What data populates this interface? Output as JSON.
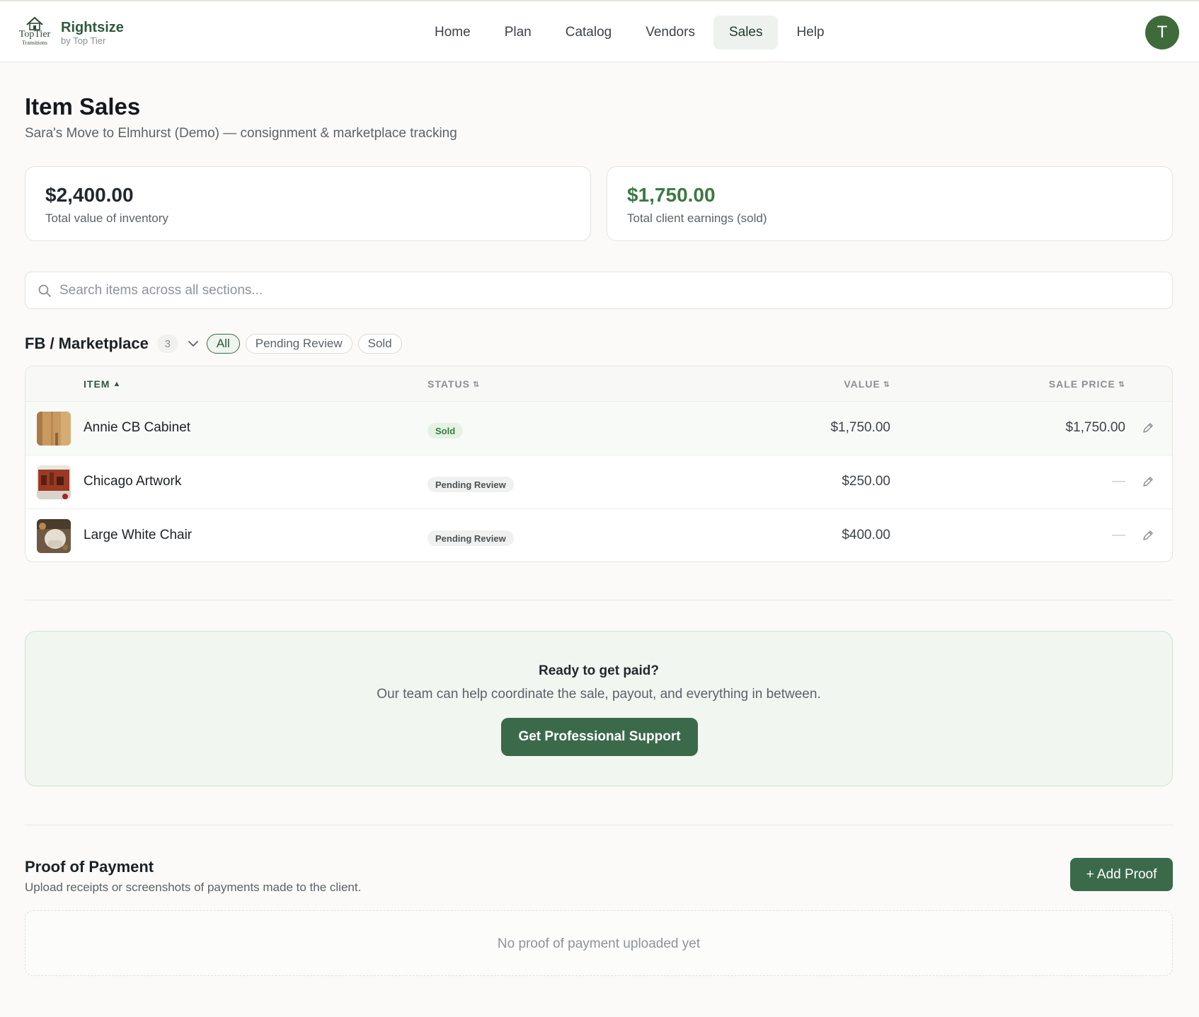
{
  "app": {
    "logo_text": "TopTier",
    "logo_sub": "Transitions",
    "brand_name": "Rightsize",
    "brand_sub": "by Top Tier"
  },
  "nav": {
    "items": [
      {
        "label": "Home"
      },
      {
        "label": "Plan"
      },
      {
        "label": "Catalog"
      },
      {
        "label": "Vendors"
      },
      {
        "label": "Sales",
        "active": true
      },
      {
        "label": "Help"
      }
    ]
  },
  "user": {
    "avatar_initial": "T"
  },
  "page": {
    "title": "Item Sales",
    "subtitle": "Sara's Move to Elmhurst (Demo) — consignment & marketplace tracking"
  },
  "stats": {
    "inventory_value": "$2,400.00",
    "inventory_label": "Total value of inventory",
    "earnings_value": "$1,750.00",
    "earnings_label": "Total client earnings (sold)"
  },
  "search": {
    "placeholder": "Search items across all sections..."
  },
  "section": {
    "title": "FB / Marketplace",
    "count": "3",
    "filters": {
      "all": "All",
      "pending": "Pending Review",
      "sold": "Sold"
    },
    "active_filter": "All"
  },
  "table": {
    "headers": {
      "item": "ITEM",
      "status": "STATUS",
      "value": "VALUE",
      "sale_price": "SALE PRICE"
    },
    "rows": [
      {
        "item": "Annie CB Cabinet",
        "status": "Sold",
        "value": "$1,750.00",
        "sale_price": "$1,750.00"
      },
      {
        "item": "Chicago Artwork",
        "status": "Pending Review",
        "value": "$250.00",
        "sale_price": "—"
      },
      {
        "item": "Large White Chair",
        "status": "Pending Review",
        "value": "$400.00",
        "sale_price": "—"
      }
    ]
  },
  "cta": {
    "title": "Ready to get paid?",
    "text": "Our team can help coordinate the sale, payout, and everything in between.",
    "button": "Get Professional Support"
  },
  "proof": {
    "title": "Proof of Payment",
    "subtitle": "Upload receipts or screenshots of payments made to the client.",
    "add_button": "+ Add Proof",
    "empty_text": "No proof of payment uploaded yet"
  },
  "colors": {
    "accent": "#3b6a4a",
    "sold_green": "#3c7a43",
    "avatar_bg": "#3f6b3a"
  }
}
